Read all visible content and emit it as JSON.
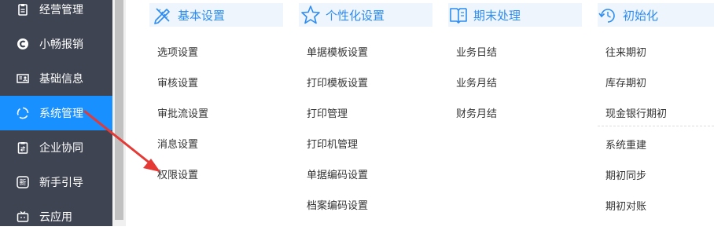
{
  "sidebar": {
    "items": [
      {
        "label": "经营管理",
        "icon": "clipboard-icon"
      },
      {
        "label": "小畅报销",
        "icon": "reimburse-c-icon"
      },
      {
        "label": "基础信息",
        "icon": "id-card-icon"
      },
      {
        "label": "系统管理",
        "icon": "loading-circle-icon",
        "active": true
      },
      {
        "label": "企业协同",
        "icon": "collaboration-icon"
      },
      {
        "label": "新手引导",
        "icon": "newbie-badge-icon"
      },
      {
        "label": "云应用",
        "icon": "tv-app-icon"
      }
    ]
  },
  "columns": [
    {
      "title": "基本设置",
      "icon": "pen-ruler-icon",
      "items": [
        "选项设置",
        "审核设置",
        "审批流设置",
        "消息设置",
        "权限设置"
      ]
    },
    {
      "title": "个性化设置",
      "icon": "star-icon",
      "items": [
        "单据模板设置",
        "打印模板设置",
        "打印管理",
        "打印机管理",
        "单据编码设置",
        "档案编码设置"
      ]
    },
    {
      "title": "期末处理",
      "icon": "book-icon",
      "items": [
        "业务日结",
        "业务月结",
        "财务月结"
      ]
    },
    {
      "title": "初始化",
      "icon": "reset-icon",
      "items": [
        "往来期初",
        "库存期初",
        "现金银行期初",
        "系统重建",
        "期初同步",
        "期初对账"
      ]
    }
  ],
  "colors": {
    "sidebar_bg": "#3f4452",
    "active_bg": "#1890ff",
    "header_bg": "#eef5fd",
    "accent": "#2d8cf0",
    "annotation_arrow": "#e53935"
  }
}
